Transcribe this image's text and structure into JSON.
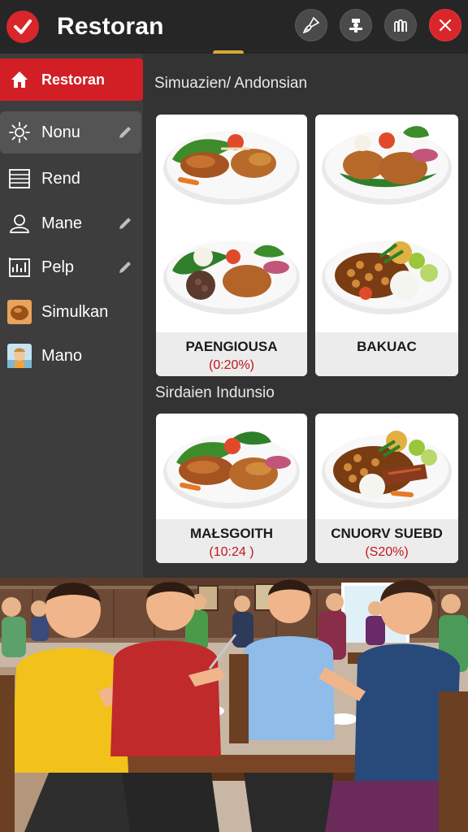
{
  "header": {
    "title": "Restoran",
    "buttons": [
      "cleaning-icon",
      "chef-icon",
      "staff-icon",
      "close-icon"
    ]
  },
  "sidebar": {
    "items": [
      {
        "label": "Restoran",
        "icon": "home-icon",
        "active": true
      },
      {
        "label": "Nonu",
        "icon": "sun-icon",
        "editable": true
      },
      {
        "label": "Rend",
        "icon": "list-icon"
      },
      {
        "label": "Mane",
        "icon": "person-icon",
        "editable": true
      },
      {
        "label": "Pelp",
        "icon": "chart-icon",
        "editable": true
      },
      {
        "label": "Simulkan",
        "icon": "food-thumb-icon"
      },
      {
        "label": "Mano",
        "icon": "avatar-thumb-icon"
      }
    ]
  },
  "main": {
    "section1_title": "Simuazien/ Andonsian",
    "section2_title": "Sirdaien Indunsio",
    "cards": [
      {
        "name": "PAENGIOUSA",
        "price": "(0:20%)"
      },
      {
        "name": "BAKUAC",
        "price": ""
      },
      {
        "name": "MAŁSGOITH",
        "price": "(10:24  )"
      },
      {
        "name": "CNUORV SUEBD",
        "price": "(S20%)"
      }
    ]
  },
  "colors": {
    "accent": "#d21f26",
    "header_bg": "#262626",
    "sidebar_bg": "#3d3d3d",
    "main_bg": "#333333",
    "price": "#c0161c"
  }
}
